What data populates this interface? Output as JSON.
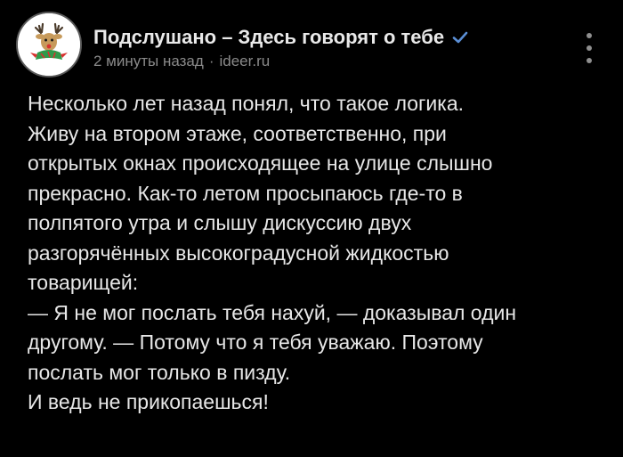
{
  "post": {
    "group_name": "Подслушано – Здесь говорят о тебе",
    "time": "2 минуты назад",
    "separator": "·",
    "source": "ideer.ru",
    "lines": [
      "Несколько лет назад понял, что такое логика.",
      "Живу на втором этаже, соответственно, при",
      "открытых окнах происходящее на улице слышно",
      "прекрасно. Как-то летом просыпаюсь где-то в",
      "полпятого утра и слышу дискуссию двух",
      "разгорячённых высокоградусной жидкостью",
      "товарищей:",
      "— Я не мог послать тебя нахуй, — доказывал один",
      "другому. — Потому что я тебя уважаю. Поэтому",
      "послать мог только в пизду.",
      "И ведь не прикопаешься!"
    ]
  },
  "icons": {
    "avatar": "reindeer-logo-icon",
    "verified": "verified-check-icon",
    "menu": "more-vertical-icon"
  },
  "colors": {
    "background": "#000000",
    "text": "#e7e7e7",
    "meta": "#8a8a8a",
    "verified": "#5b8fd6"
  }
}
